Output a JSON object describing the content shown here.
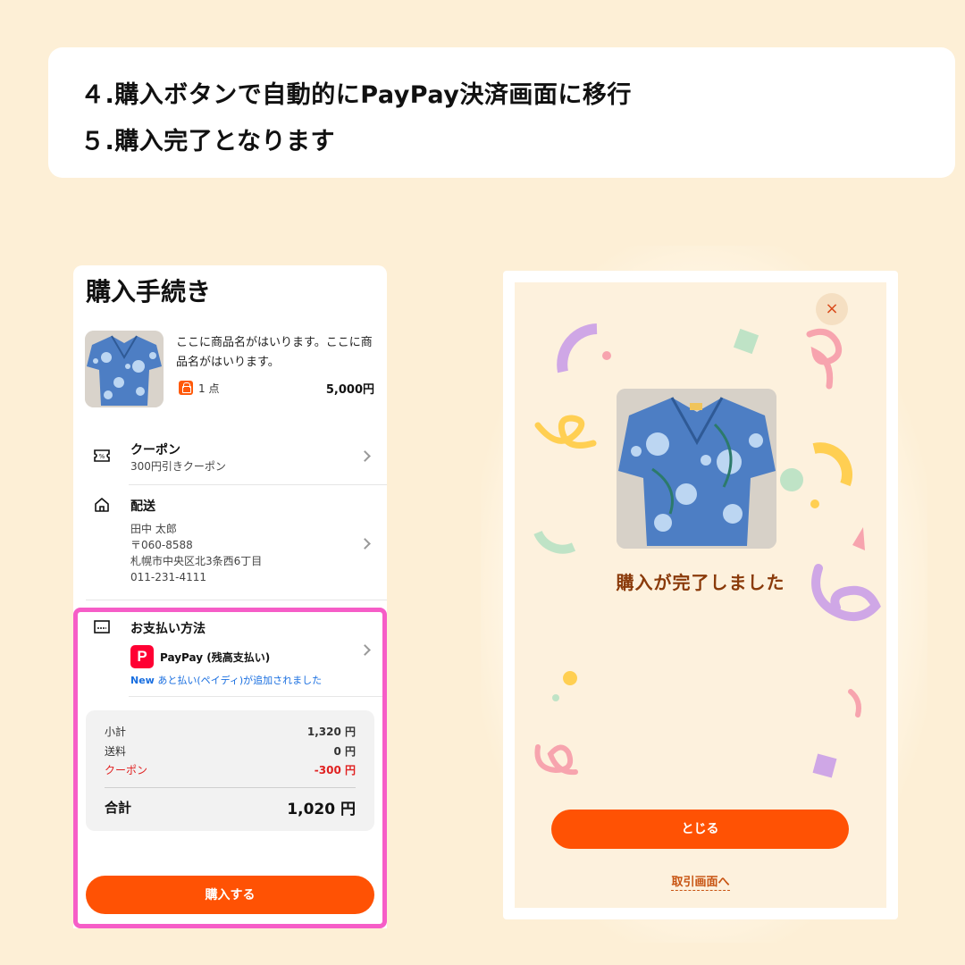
{
  "header": {
    "line1": "４.購入ボタンで自動的にPayPay決済画面に移行",
    "line2": "５.購入完了となります"
  },
  "checkout": {
    "title": "購入手続き",
    "product": {
      "name": "ここに商品名がはいります。ここに商品名がはいります。",
      "quantity": "1 点",
      "price": "5,000円"
    },
    "coupon": {
      "title": "クーポン",
      "subtitle": "300円引きクーポン"
    },
    "shipping": {
      "title": "配送",
      "name": "田中 太郎",
      "postal": "〒060-8588",
      "address": "札幌市中央区北3条西6丁目",
      "phone": "011-231-4111"
    },
    "payment": {
      "title": "お支払い方法",
      "method": "PayPay (残高支払い)",
      "logo_letter": "P",
      "new_badge": "New",
      "new_text": "あと払い(ペイディ)が追加されました"
    },
    "summary": {
      "subtotal_label": "小計",
      "subtotal_value": "1,320 円",
      "shipping_label": "送料",
      "shipping_value": "0 円",
      "coupon_label": "クーポン",
      "coupon_value": "-300 円",
      "total_label": "合計",
      "total_value": "1,020 円"
    },
    "buy_button": "購入する"
  },
  "complete": {
    "close_icon": "×",
    "message": "購入が完了しました",
    "close_button": "とじる",
    "trade_link": "取引画面へ"
  },
  "colors": {
    "background": "#fdefd6",
    "accent": "#ff5204",
    "highlight": "#f65dc7",
    "paypay": "#ff0033",
    "message": "#8a3a0a"
  }
}
